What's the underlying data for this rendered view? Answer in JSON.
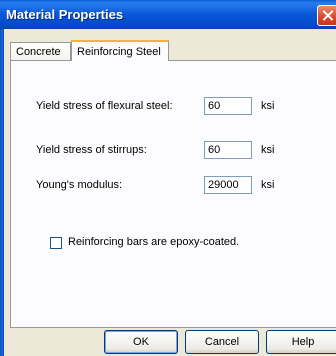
{
  "window": {
    "title": "Material Properties"
  },
  "tabs": [
    {
      "label": "Concrete",
      "selected": false
    },
    {
      "label": "Reinforcing Steel",
      "selected": true
    }
  ],
  "fields": [
    {
      "label": "Yield stress of flexural steel:",
      "value": "60",
      "unit": "ksi"
    },
    {
      "label": "Yield stress of stirrups:",
      "value": "60",
      "unit": "ksi"
    },
    {
      "label": "Young's modulus:",
      "value": "29000",
      "unit": "ksi"
    }
  ],
  "epoxy": {
    "label": "Reinforcing bars are epoxy-coated.",
    "checked": false
  },
  "buttons": {
    "ok": "OK",
    "cancel": "Cancel",
    "help": "Help"
  },
  "colors": {
    "titlebar": "#0758d8",
    "dialog_bg": "#ece9d8",
    "panel_bg": "#fcfcfe",
    "tab_highlight": "#f3b33d",
    "close": "#d6482a"
  }
}
